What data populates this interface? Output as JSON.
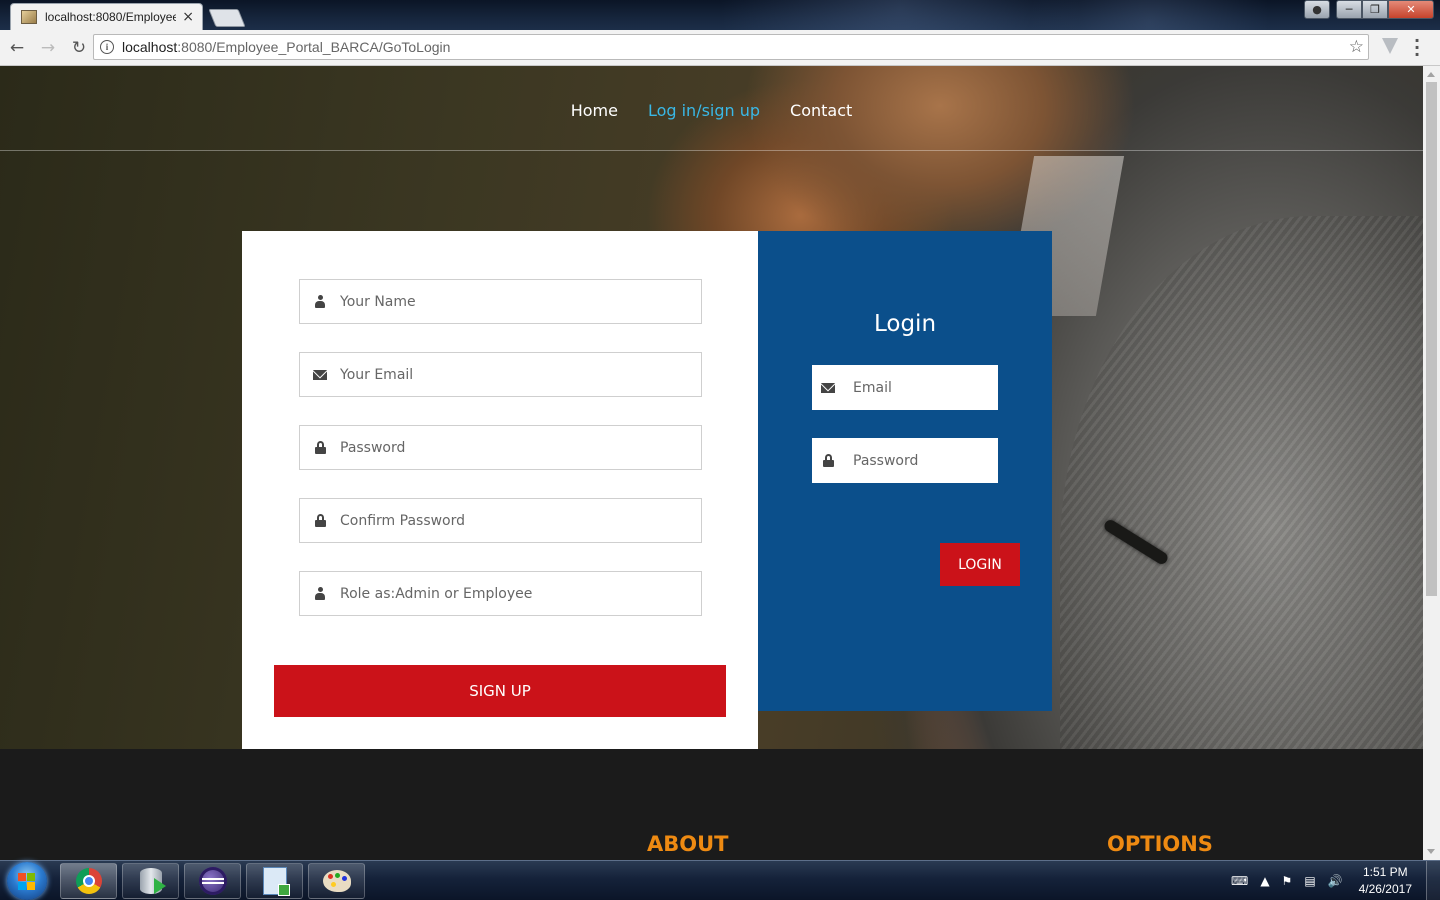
{
  "browser": {
    "tab_title": "localhost:8080/Employee",
    "tab_close": "×",
    "address_host": "localhost",
    "address_rest": ":8080/Employee_Portal_BARCA/GoToLogin"
  },
  "nav": {
    "items": [
      {
        "label": "Home"
      },
      {
        "label": "Log in/sign up"
      },
      {
        "label": "Contact"
      }
    ],
    "active_color": "#39b8e6"
  },
  "signup": {
    "fields": [
      {
        "placeholder": "Your Name",
        "icon": "user-icon"
      },
      {
        "placeholder": "Your Email",
        "icon": "envelope-icon"
      },
      {
        "placeholder": "Password",
        "icon": "lock-icon"
      },
      {
        "placeholder": "Confirm Password",
        "icon": "lock-icon"
      },
      {
        "placeholder": "Role as:Admin or Employee",
        "icon": "user-icon"
      }
    ],
    "button_label": "SIGN UP"
  },
  "login": {
    "title": "Login",
    "fields": [
      {
        "placeholder": "Email",
        "icon": "envelope-icon"
      },
      {
        "placeholder": "Password",
        "icon": "lock-icon"
      }
    ],
    "button_label": "LOGIN",
    "panel_color": "#0b4f8b"
  },
  "footer": {
    "about_heading": "ABOUT",
    "options_heading": "OPTIONS",
    "heading_color": "#ee8a12"
  },
  "colors": {
    "accent_red": "#cb1219",
    "footer_bg": "#1b1b1b"
  },
  "taskbar": {
    "apps": [
      "chrome-icon",
      "database-icon",
      "eclipse-icon",
      "document-icon",
      "paint-icon"
    ],
    "time": "1:51 PM",
    "date": "4/26/2017"
  }
}
